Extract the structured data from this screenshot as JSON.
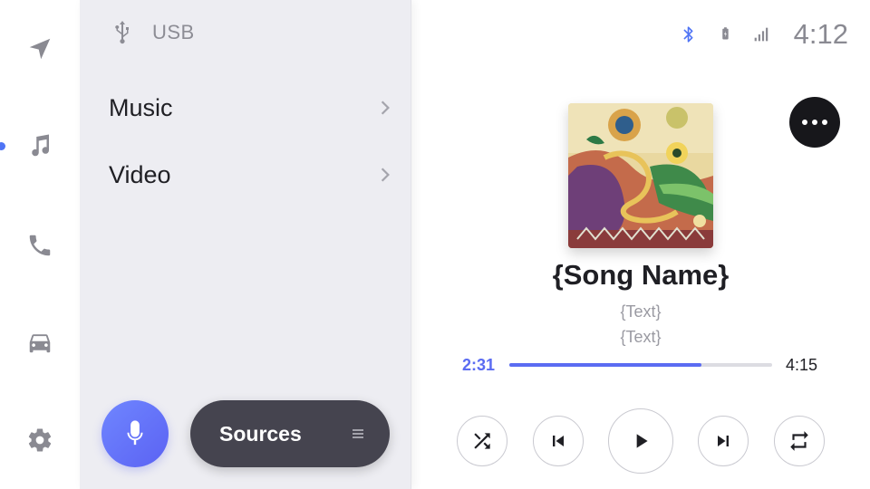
{
  "rail": {
    "items": [
      {
        "name": "navigation",
        "icon": "navigation-arrow-icon"
      },
      {
        "name": "music",
        "icon": "music-note-icon",
        "active": true
      },
      {
        "name": "phone",
        "icon": "phone-icon"
      },
      {
        "name": "vehicle",
        "icon": "car-icon"
      },
      {
        "name": "settings",
        "icon": "gear-icon"
      }
    ],
    "active_color": "#4f74f5"
  },
  "panel": {
    "source_icon": "usb-icon",
    "title": "USB",
    "items": [
      {
        "label": "Music",
        "icon": "chevron-right-icon"
      },
      {
        "label": "Video",
        "icon": "chevron-right-icon"
      }
    ],
    "voice_icon": "microphone-icon",
    "sources_label": "Sources",
    "sources_icon": "menu-lines-icon"
  },
  "status": {
    "icons": [
      "bluetooth-icon",
      "phone-battery-icon",
      "signal-bars-icon"
    ],
    "bluetooth_color": "#4f74f5",
    "time": "4:12"
  },
  "player": {
    "album_art": "album-art",
    "song_name": "{Song Name}",
    "line1": "{Text}",
    "line2": "{Text}",
    "elapsed": "2:31",
    "duration": "4:15",
    "progress": 0.73,
    "accent_color": "#5b6cf2",
    "controls": [
      "shuffle-icon",
      "previous-track-icon",
      "play-icon",
      "next-track-icon",
      "repeat-icon"
    ],
    "more_icon": "more-dots-icon"
  }
}
